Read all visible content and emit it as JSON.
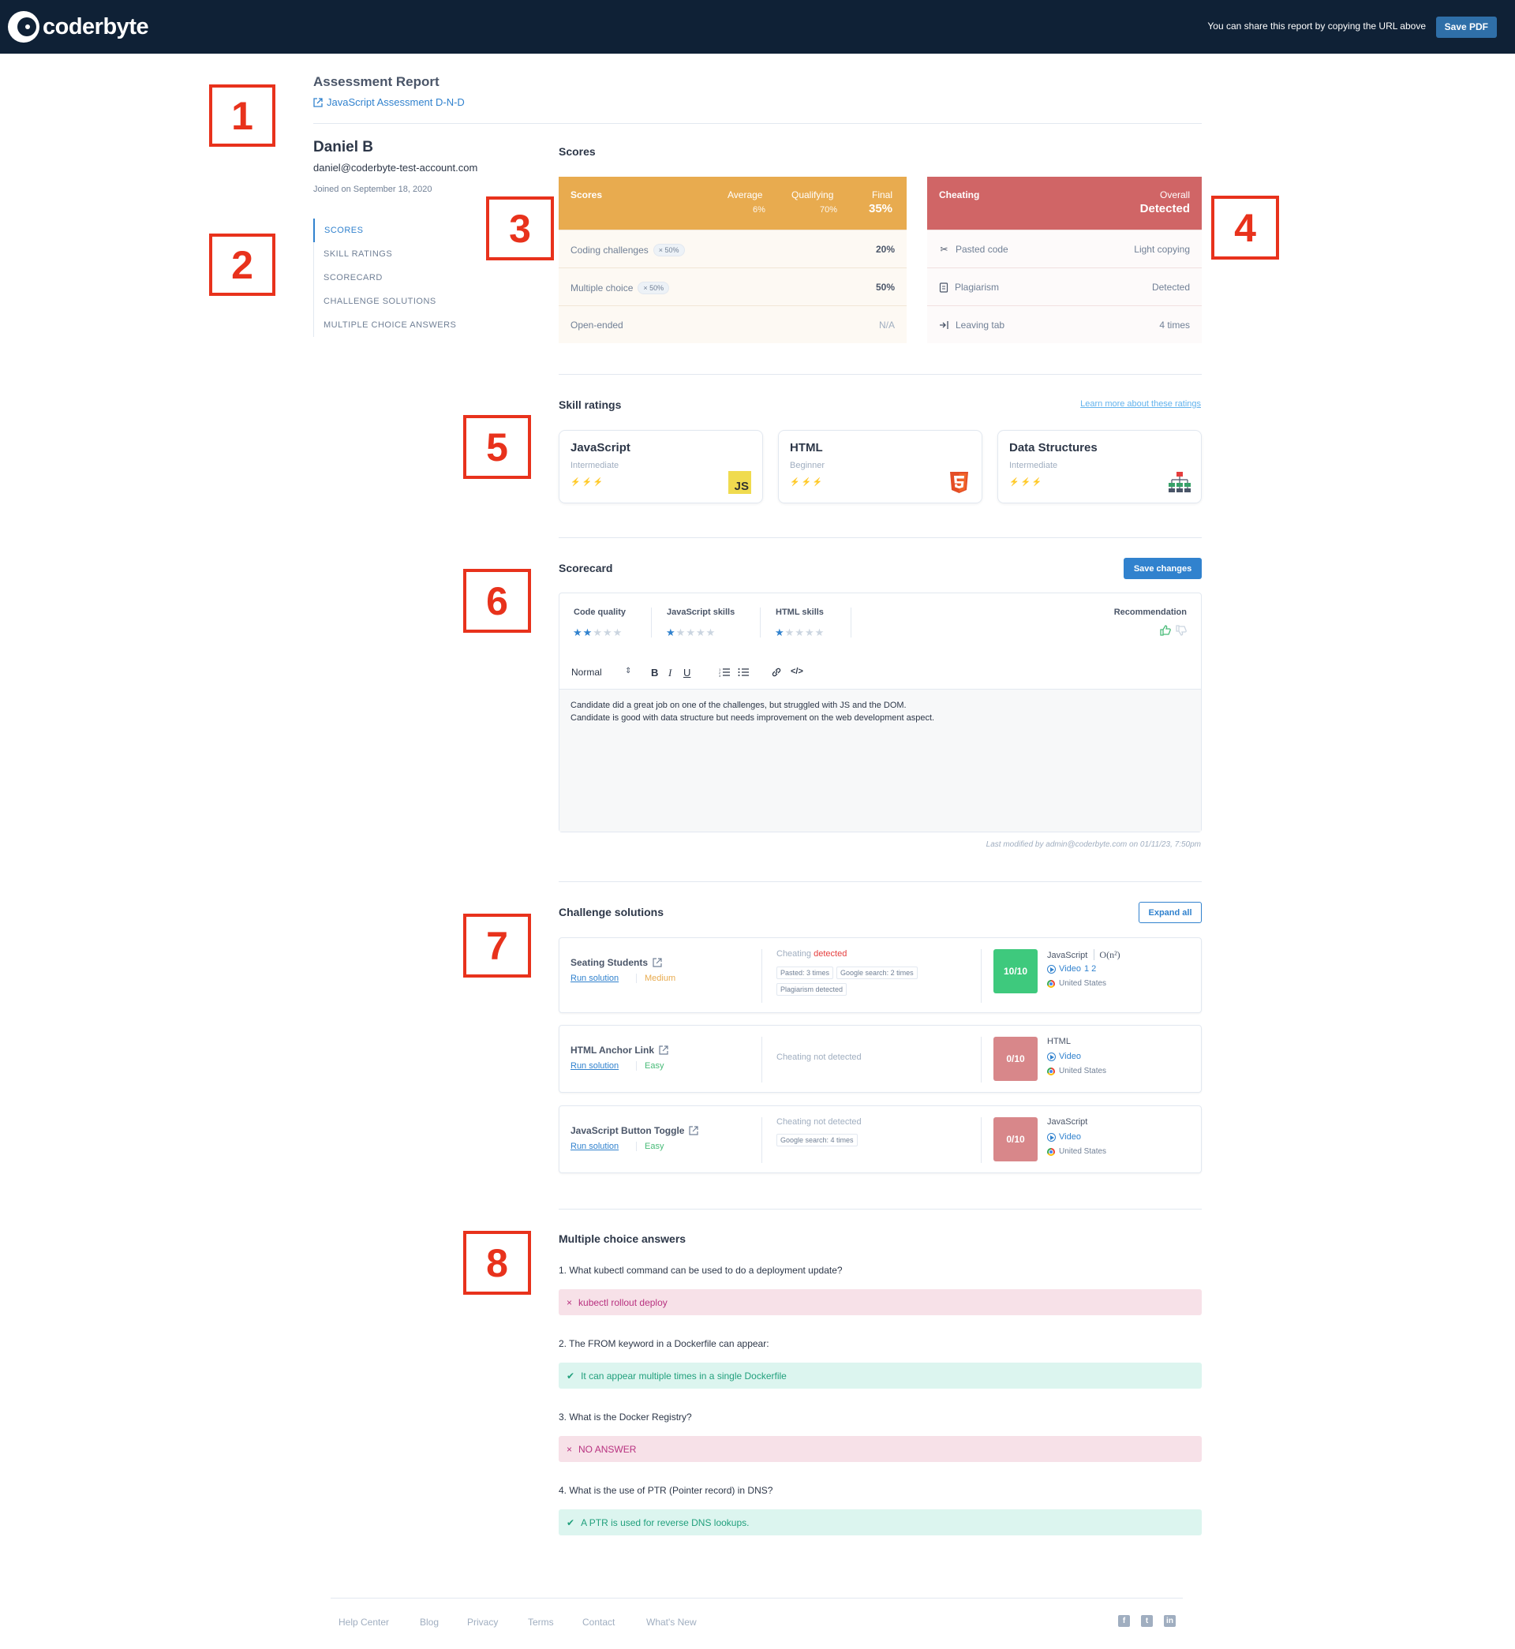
{
  "topbar": {
    "logo_text": "coderbyte",
    "share_text": "You can share this report by copying the URL above",
    "save_pdf_label": "Save PDF"
  },
  "annotations": [
    "1",
    "2",
    "3",
    "4",
    "5",
    "6",
    "7",
    "8"
  ],
  "header": {
    "title": "Assessment Report",
    "assessment_link": "JavaScript Assessment D-N-D"
  },
  "candidate": {
    "name": "Daniel B",
    "email": "daniel@coderbyte-test-account.com",
    "joined": "Joined on September 18, 2020"
  },
  "sidenav": {
    "items": [
      "SCORES",
      "SKILL RATINGS",
      "SCORECARD",
      "CHALLENGE SOLUTIONS",
      "MULTIPLE CHOICE ANSWERS"
    ],
    "active": "SCORES"
  },
  "scores": {
    "section_title": "Scores",
    "head_label": "Scores",
    "average_label": "Average",
    "average_value": "6%",
    "qualifying_label": "Qualifying",
    "qualifying_value": "70%",
    "final_label": "Final",
    "final_value": "35%",
    "rows": [
      {
        "name": "Coding challenges",
        "weight": "× 50%",
        "value": "20%"
      },
      {
        "name": "Multiple choice",
        "weight": "× 50%",
        "value": "50%"
      },
      {
        "name": "Open-ended",
        "weight": "",
        "value": "N/A"
      }
    ],
    "color": "#e8ab4f"
  },
  "cheating": {
    "head_label": "Cheating",
    "overall_label": "Overall",
    "overall_value": "Detected",
    "rows": [
      {
        "icon": "scissors-icon",
        "name": "Pasted code",
        "value": "Light copying"
      },
      {
        "icon": "document-icon",
        "name": "Plagiarism",
        "value": "Detected"
      },
      {
        "icon": "exit-tab-icon",
        "name": "Leaving tab",
        "value": "4 times"
      }
    ],
    "color": "#d06566"
  },
  "skills": {
    "section_title": "Skill ratings",
    "learn_more": "Learn more about these ratings",
    "cards": [
      {
        "name": "JavaScript",
        "level": "Intermediate",
        "rating": 2,
        "max": 3,
        "icon": "javascript-icon",
        "icon_text": "JS"
      },
      {
        "name": "HTML",
        "level": "Beginner",
        "rating": 1,
        "max": 3,
        "icon": "html5-icon"
      },
      {
        "name": "Data Structures",
        "level": "Intermediate",
        "rating": 2,
        "max": 3,
        "icon": "data-structure-icon"
      }
    ]
  },
  "scorecard": {
    "section_title": "Scorecard",
    "save_label": "Save changes",
    "ratings": [
      {
        "label": "Code quality",
        "stars": 2,
        "max": 5
      },
      {
        "label": "JavaScript skills",
        "stars": 1,
        "max": 5
      },
      {
        "label": "HTML skills",
        "stars": 1,
        "max": 5
      }
    ],
    "recommendation_label": "Recommendation",
    "toolbar_format": "Normal",
    "text_line_1": "Candidate did a great job on one of the challenges, but struggled with JS and the DOM.",
    "text_line_2": "Candidate is good with data structure but needs improvement on the web development aspect.",
    "last_modified": "Last modified by admin@coderbyte.com on 01/11/23, 7:50pm"
  },
  "challenges": {
    "section_title": "Challenge solutions",
    "expand_label": "Expand all",
    "items": [
      {
        "name": "Seating Students",
        "run_label": "Run solution",
        "difficulty": "Medium",
        "cheat_prefix": "Cheating",
        "cheat_status": "detected",
        "tags": [
          "Pasted: 3 times",
          "Google search: 2 times",
          "Plagiarism detected"
        ],
        "score": "10/10",
        "language": "JavaScript",
        "complexity": "O(n²)",
        "video_label": "Video",
        "video_parts": "1  2",
        "location": "United States"
      },
      {
        "name": "HTML Anchor Link",
        "run_label": "Run solution",
        "difficulty": "Easy",
        "cheat_text": "Cheating not detected",
        "tags": [],
        "score": "0/10",
        "language": "HTML",
        "video_label": "Video",
        "location": "United States"
      },
      {
        "name": "JavaScript Button Toggle",
        "run_label": "Run solution",
        "difficulty": "Easy",
        "cheat_text": "Cheating not detected",
        "tags": [
          "Google search: 4 times"
        ],
        "score": "0/10",
        "language": "JavaScript",
        "video_label": "Video",
        "location": "United States"
      }
    ]
  },
  "multiple_choice": {
    "section_title": "Multiple choice answers",
    "items": [
      {
        "question": "1. What kubectl command can be used to do a deployment update?",
        "answer": "kubectl rollout deploy",
        "correct": false
      },
      {
        "question": "2. The FROM keyword in a Dockerfile can appear:",
        "answer": "It can appear multiple times in a single Dockerfile",
        "correct": true
      },
      {
        "question": "3. What is the Docker Registry?",
        "answer": "NO ANSWER",
        "correct": false
      },
      {
        "question": "4. What is the use of PTR (Pointer record) in DNS?",
        "answer": "A PTR is used for reverse DNS lookups.",
        "correct": true
      }
    ]
  },
  "footer": {
    "links": [
      "Help Center",
      "Blog",
      "Privacy",
      "Terms",
      "Contact",
      "What's New"
    ],
    "social": [
      "facebook-icon",
      "twitter-icon",
      "linkedin-icon"
    ]
  }
}
